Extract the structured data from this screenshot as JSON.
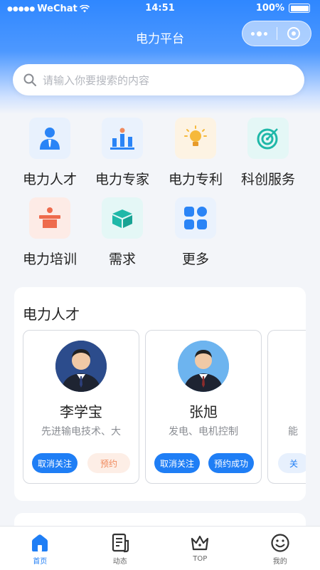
{
  "status_bar": {
    "carrier": "WeChat",
    "time": "14:51",
    "battery": "100%"
  },
  "nav": {
    "title": "电力平台"
  },
  "search": {
    "placeholder": "请输入你要搜索的内容"
  },
  "grid": [
    {
      "label": "电力人才",
      "icon": "talent-icon"
    },
    {
      "label": "电力专家",
      "icon": "expert-icon"
    },
    {
      "label": "电力专利",
      "icon": "patent-icon"
    },
    {
      "label": "科创服务",
      "icon": "innovation-service-icon"
    },
    {
      "label": "电力培训",
      "icon": "training-icon"
    },
    {
      "label": "需求",
      "icon": "demand-icon"
    },
    {
      "label": "更多",
      "icon": "more-icon"
    }
  ],
  "talent_section": {
    "title": "电力人才",
    "cards": [
      {
        "name": "李学宝",
        "field": "先进输电技术、大",
        "btn1": "取消关注",
        "btn2": "预约"
      },
      {
        "name": "张旭",
        "field": "发电、电机控制",
        "btn1": "取消关注",
        "btn2": "预约成功"
      },
      {
        "name": "",
        "field": "能",
        "btn1": "关",
        "btn2": ""
      }
    ]
  },
  "tabbar": [
    {
      "label": "首页",
      "icon": "home-icon",
      "active": true
    },
    {
      "label": "动态",
      "icon": "news-icon",
      "active": false
    },
    {
      "label": "TOP",
      "icon": "crown-icon",
      "active": false
    },
    {
      "label": "我的",
      "icon": "profile-icon",
      "active": false
    }
  ],
  "colors": {
    "primary": "#1f7ef5",
    "accent_orange": "#f08a5d"
  }
}
